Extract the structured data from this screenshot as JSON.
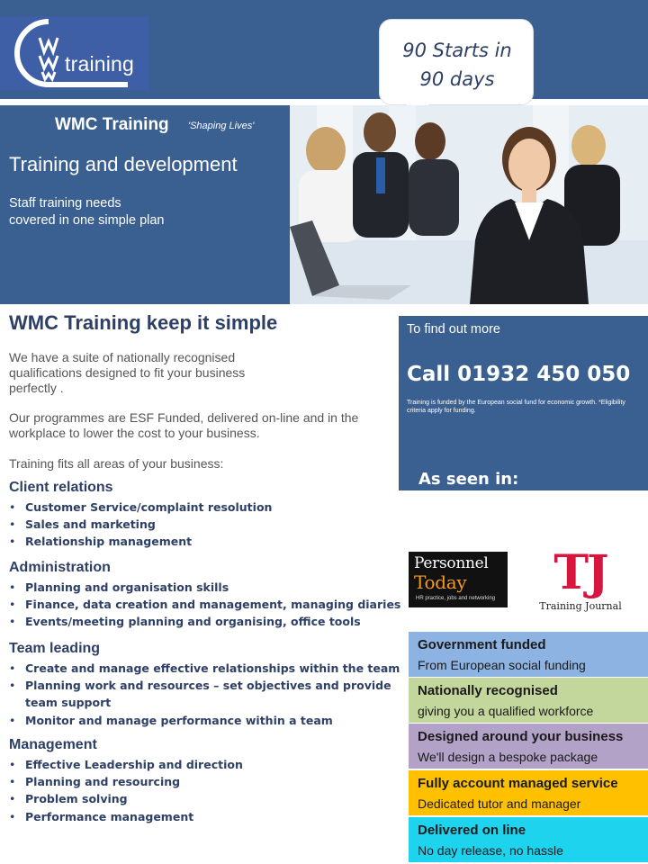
{
  "header": {
    "logo_text": "training",
    "bubble_line1": "90 Starts in",
    "bubble_line2": "90 days"
  },
  "hero": {
    "brand_title": "WMC Training",
    "tagline": "'Shaping Lives'",
    "heading": "Training and development",
    "sub_line1": "Staff training needs",
    "sub_line2": "covered in one simple plan"
  },
  "main": {
    "heading": "WMC Training keep it simple",
    "paragraphs": [
      "We have a suite of nationally recognised qualifications designed to fit your business perfectly .",
      "Our programmes are ESF Funded, delivered on-line and in the workplace to lower the cost to your business.",
      "Training fits all areas of your business:"
    ],
    "sections": [
      {
        "title": "Client relations",
        "items": [
          "Customer Service/complaint resolution",
          "Sales and marketing",
          "Relationship management"
        ]
      },
      {
        "title": "Administration",
        "items": [
          "Planning and organisation skills",
          "Finance, data creation and management, managing diaries",
          "Events/meeting planning and organising, office tools"
        ]
      },
      {
        "title": "Team leading",
        "items": [
          "Create and manage effective relationships within the team",
          "Planning work and resources – set objectives and  provide",
          "team support",
          "Monitor and manage performance within a team"
        ]
      },
      {
        "title": "Management",
        "items": [
          "Effective Leadership and direction",
          "Planning and resourcing",
          "Problem solving",
          "Performance management"
        ]
      }
    ]
  },
  "info": {
    "find_out": "To find out more",
    "phone": "Call 01932 450 050",
    "note": "Training is funded by the European social fund for economic growth. *Eligibility criteria apply for funding.",
    "seen_in": "As seen in:"
  },
  "logos": {
    "pt_line1": "Personnel",
    "pt_line2": "Today",
    "pt_tag": "HR practice, jobs and networking",
    "tj_letters": "TJ",
    "tj_name": "Training Journal"
  },
  "features": [
    {
      "title": "Government funded",
      "subtitle": "From European social funding",
      "color": "#8db3e2"
    },
    {
      "title": "Nationally recognised",
      "subtitle": "giving you a qualified workforce",
      "color": "#c3d69b"
    },
    {
      "title": "Designed around your business",
      "subtitle": "We'll design a bespoke package",
      "color": "#b3a2c7"
    },
    {
      "title": "Fully account managed service",
      "subtitle": "Dedicated tutor  and  manager",
      "color": "#ffc000"
    },
    {
      "title": "Delivered on line",
      "subtitle": "No day release, no hassle",
      "color": "#1ed3ed"
    }
  ]
}
